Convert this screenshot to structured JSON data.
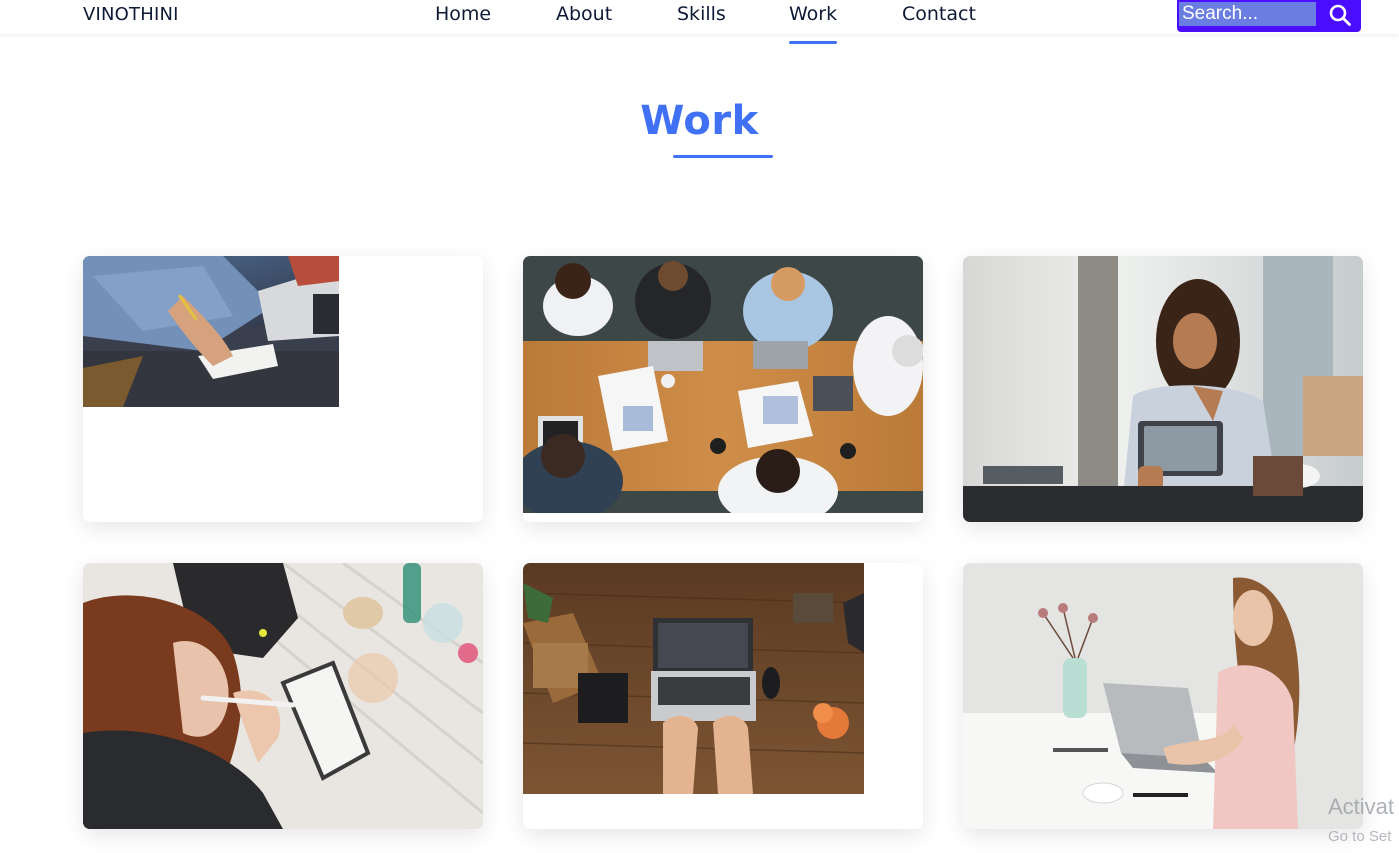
{
  "brand": {
    "name": "VINOTHINI"
  },
  "nav": {
    "items": [
      {
        "label": "Home"
      },
      {
        "label": "About"
      },
      {
        "label": "Skills"
      },
      {
        "label": "Work",
        "active": true
      },
      {
        "label": "Contact"
      }
    ]
  },
  "search": {
    "placeholder": "Search...",
    "icon": "search-icon"
  },
  "section": {
    "title": "Work"
  },
  "work_cards": [
    {
      "image": "hand-writing-notes-laptop-photo"
    },
    {
      "image": "team-meeting-handshake-table-photo"
    },
    {
      "image": "woman-using-tablet-office-photo"
    },
    {
      "image": "woman-with-pen-desk-topview-photo"
    },
    {
      "image": "hands-typing-laptop-wooden-desk-photo"
    },
    {
      "image": "woman-typing-laptop-white-desk-photo"
    }
  ],
  "watermark": {
    "line1": "Activat",
    "line2": "Go to Set"
  },
  "colors": {
    "accent": "#4070f4",
    "text": "#0e1a36",
    "search_bg": "#4a0dff",
    "search_field": "#6a7de0"
  }
}
